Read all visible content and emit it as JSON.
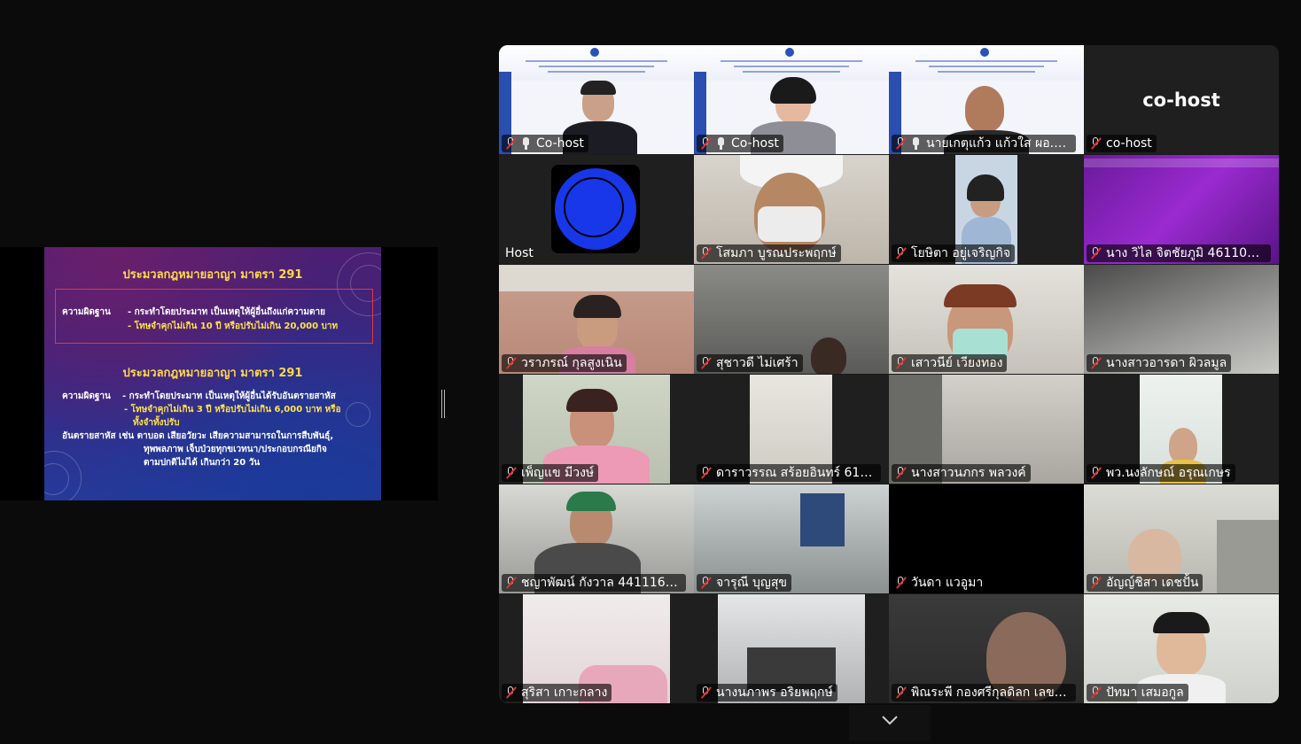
{
  "shared_screen": {
    "title1": "ประมวลกฎหมายอาญา มาตรา 291",
    "box_label": "ความผิดฐาน",
    "box_line1": "- กระทำโดยประมาท เป็นเหตุให้ผู้อื่นถึงแก่ความตาย",
    "box_line2": "- โทษจำคุกไม่เกิน 10 ปี หรือปรับไม่เกิน 20,000 บาท",
    "title2": "ประมวลกฎหมายอาญา มาตรา 291",
    "s2_label": "ความผิดฐาน",
    "s2_line1": "- กระทำโดยประมาท เป็นเหตุให้ผู้อื่นได้รับอันตรายสาหัส",
    "s2_line2": "- โทษจำคุกไม่เกิน 3 ปี หรือปรับไม่เกิน 6,000 บาท หรือ",
    "s2_line3": "ทั้งจำทั้งปรับ",
    "s2_line4": "อันตรายสาหัส เช่น ตาบอด เสียอวัยวะ เสียความสามารถในการสืบพันธุ์,",
    "s2_line5": "ทุพพลภาพ เจ็บป่วยทุกขเวทนา/ประกอบกรณียกิจ",
    "s2_line6": "ตามปกติไม่ได้ เกินกว่า 20 วัน"
  },
  "tiles": [
    {
      "name": "Co-host",
      "raise": true
    },
    {
      "name": "Co-host",
      "raise": true
    },
    {
      "name": "นายเกตุแก้ว แก้วใส ผอ.สำ...",
      "raise": true
    },
    {
      "name": "co-host",
      "big_label": "co-host"
    },
    {
      "name": "Host"
    },
    {
      "name": "โสมภา บูรณประพฤกษ์"
    },
    {
      "name": "โยษิตา อยู่เจริญกิจ"
    },
    {
      "name": "นาง วิไล จิตชัยภูมิ 4611013..."
    },
    {
      "name": "วราภรณ์ กุลสูงเนิน"
    },
    {
      "name": "สุชาวดี ไม่เศร้า"
    },
    {
      "name": "เสาวนีย์ เวียงทอง"
    },
    {
      "name": "นางสาวอารดา ผิวลมูล"
    },
    {
      "name": "เพ็ญแข  มีวงษ์"
    },
    {
      "name": "ดาราวรรณ สร้อยอินทร์ 6111..."
    },
    {
      "name": "นางสาวนภกร พลวงค์"
    },
    {
      "name": "พว.นงลักษณ์ อรุณเกษร"
    },
    {
      "name": "ชญาพัฒน์  กังวาล 4411163..."
    },
    {
      "name": "จารุณี บุญสุข"
    },
    {
      "name": "วันดา แวอูมา"
    },
    {
      "name": "อัญญ์ชิสา เดชปั้น"
    },
    {
      "name": "สุริสา เกาะกลาง"
    },
    {
      "name": "นางนภาพร อริยพฤกษ์"
    },
    {
      "name": "พิณระพี กองศรีกุลดิลก เลขที่ใ..."
    },
    {
      "name": "ปัทมา เสมอกูล"
    }
  ]
}
